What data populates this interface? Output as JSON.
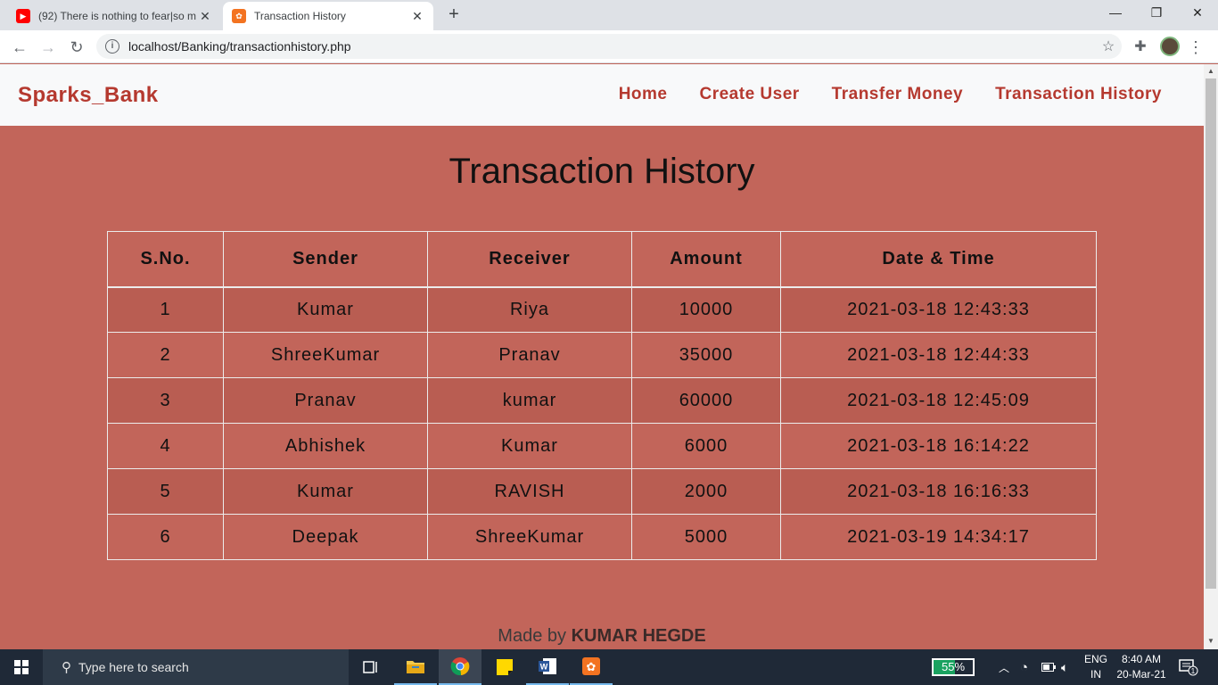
{
  "browser": {
    "tabs": [
      {
        "title": "(92) There is nothing to fear|so m",
        "active": false
      },
      {
        "title": "Transaction History",
        "active": true
      }
    ],
    "url": "localhost/Banking/transactionhistory.php"
  },
  "navbar": {
    "brand": "Sparks_Bank",
    "links": [
      "Home",
      "Create User",
      "Transfer Money",
      "Transaction History"
    ]
  },
  "page": {
    "title": "Transaction History",
    "table": {
      "headers": [
        "S.No.",
        "Sender",
        "Receiver",
        "Amount",
        "Date & Time"
      ],
      "rows": [
        [
          "1",
          "Kumar",
          "Riya",
          "10000",
          "2021-03-18 12:43:33"
        ],
        [
          "2",
          "ShreeKumar",
          "Pranav",
          "35000",
          "2021-03-18 12:44:33"
        ],
        [
          "3",
          "Pranav",
          "kumar",
          "60000",
          "2021-03-18 12:45:09"
        ],
        [
          "4",
          "Abhishek",
          "Kumar",
          "6000",
          "2021-03-18 16:14:22"
        ],
        [
          "5",
          "Kumar",
          "RAVISH",
          "2000",
          "2021-03-18 16:16:33"
        ],
        [
          "6",
          "Deepak",
          "ShreeKumar",
          "5000",
          "2021-03-19 14:34:17"
        ]
      ]
    },
    "footer": {
      "prefix": "Made by",
      "author": "KUMAR HEGDE"
    }
  },
  "taskbar": {
    "search_placeholder": "Type here to search",
    "battery": "55%",
    "lang_top": "ENG",
    "lang_bottom": "IN",
    "time": "8:40 AM",
    "date": "20-Mar-21",
    "notifications": "1"
  },
  "colors": {
    "page_bg": "#c2655a",
    "brand": "#b5392f",
    "navbar_bg": "#f8f9fa",
    "taskbar_bg": "#1f2937"
  }
}
